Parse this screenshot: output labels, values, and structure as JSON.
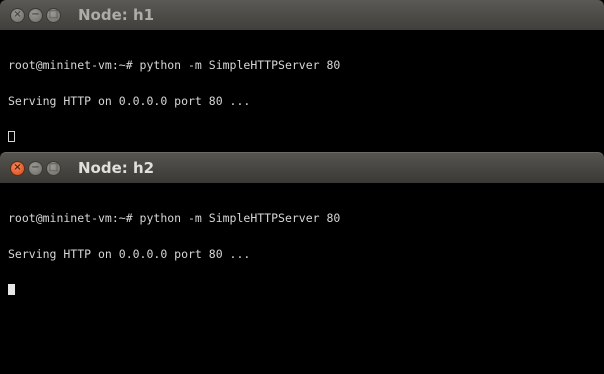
{
  "windows": [
    {
      "title": "Node: h1",
      "focused": false,
      "lines": [
        "root@mininet-vm:~# python -m SimpleHTTPServer 80",
        "Serving HTTP on 0.0.0.0 port 80 ..."
      ]
    },
    {
      "title": "Node: h2",
      "focused": true,
      "lines": [
        "root@mininet-vm:~# python -m SimpleHTTPServer 80",
        "Serving HTTP on 0.0.0.0 port 80 ..."
      ]
    }
  ],
  "colors": {
    "terminal_bg": "#000000",
    "terminal_fg": "#d6d6d6",
    "close_active": "#e05a2a",
    "titlebar": "#4a4945"
  },
  "icons": {
    "close": "close-icon",
    "minimize": "minimize-icon",
    "maximize": "maximize-icon"
  }
}
